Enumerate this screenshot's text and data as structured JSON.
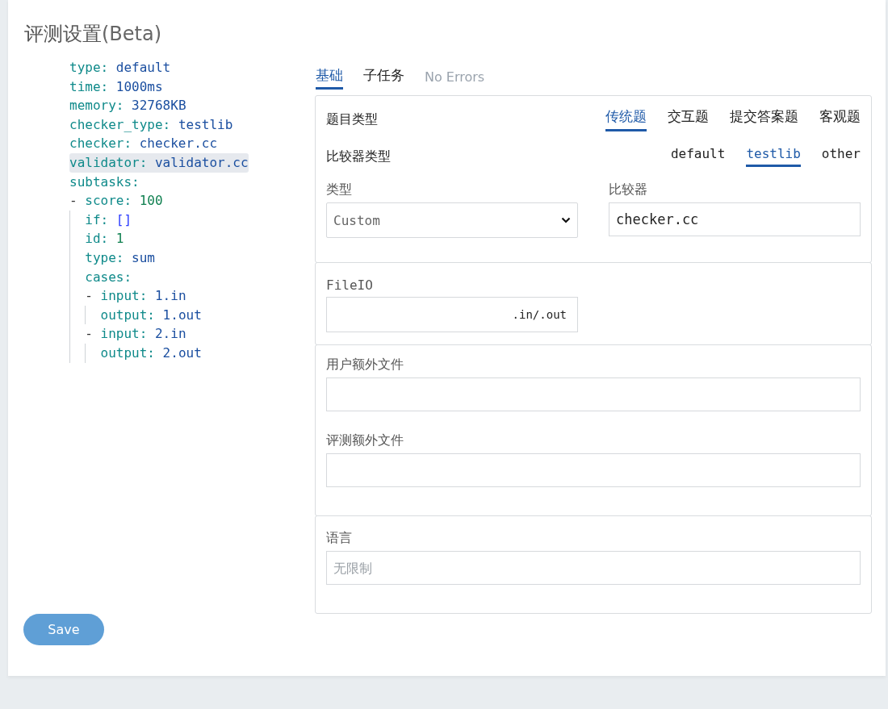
{
  "page": {
    "title": "评测设置",
    "title_suffix": "(Beta)"
  },
  "editor": {
    "lines": [
      {
        "key": "type:",
        "value": "default",
        "kind": "string",
        "highlighted": false
      },
      {
        "key": "time:",
        "value": "1000ms",
        "kind": "string",
        "highlighted": false
      },
      {
        "key": "memory:",
        "value": "32768KB",
        "kind": "string",
        "highlighted": false
      },
      {
        "key": "checker_type:",
        "value": "testlib",
        "kind": "string",
        "highlighted": false
      },
      {
        "key": "checker:",
        "value": "checker.cc",
        "kind": "string",
        "highlighted": false
      },
      {
        "key": "validator:",
        "value": "validator.cc",
        "kind": "string",
        "highlighted": true
      },
      {
        "key": "subtasks:",
        "highlighted": false
      },
      {
        "dash": "-",
        "key": "score:",
        "value": "100",
        "kind": "number",
        "highlighted": false,
        "children": [
          {
            "key": "if:",
            "value": "[]",
            "kind": "bracket",
            "highlighted": false
          },
          {
            "key": "id:",
            "value": "1",
            "kind": "number",
            "highlighted": false
          },
          {
            "key": "type:",
            "value": "sum",
            "kind": "string",
            "highlighted": false
          },
          {
            "key": "cases:",
            "highlighted": false
          },
          {
            "dash": "-",
            "key": "input:",
            "value": "1.in",
            "kind": "string",
            "highlighted": false,
            "children": [
              {
                "key": "output:",
                "value": "1.out",
                "kind": "string",
                "highlighted": false
              }
            ]
          },
          {
            "dash": "-",
            "key": "input:",
            "value": "2.in",
            "kind": "string",
            "highlighted": false,
            "children": [
              {
                "key": "output:",
                "value": "2.out",
                "kind": "string",
                "highlighted": false
              }
            ]
          }
        ]
      }
    ]
  },
  "tabs": [
    {
      "label": "基础",
      "selected": true
    },
    {
      "label": "子任务",
      "selected": false
    }
  ],
  "status": "No Errors",
  "basic": {
    "problem_type": {
      "label": "题目类型",
      "options": [
        {
          "label": "传统题",
          "selected": true
        },
        {
          "label": "交互题",
          "selected": false
        },
        {
          "label": "提交答案题",
          "selected": false
        },
        {
          "label": "客观题",
          "selected": false
        }
      ]
    },
    "checker_type": {
      "label": "比较器类型",
      "options": [
        {
          "label": "default",
          "selected": false
        },
        {
          "label": "testlib",
          "selected": true
        },
        {
          "label": "other",
          "selected": false
        }
      ]
    },
    "type_select": {
      "label": "类型",
      "value": "Custom"
    },
    "checker_field": {
      "label": "比较器",
      "value": "checker.cc"
    }
  },
  "fileio": {
    "label": "FileIO",
    "suffix": ".in/.out"
  },
  "extra_files": [
    {
      "label": "用户额外文件"
    },
    {
      "label": "评测额外文件"
    }
  ],
  "language": {
    "label": "语言",
    "placeholder": "无限制"
  },
  "save_button": "Save"
}
